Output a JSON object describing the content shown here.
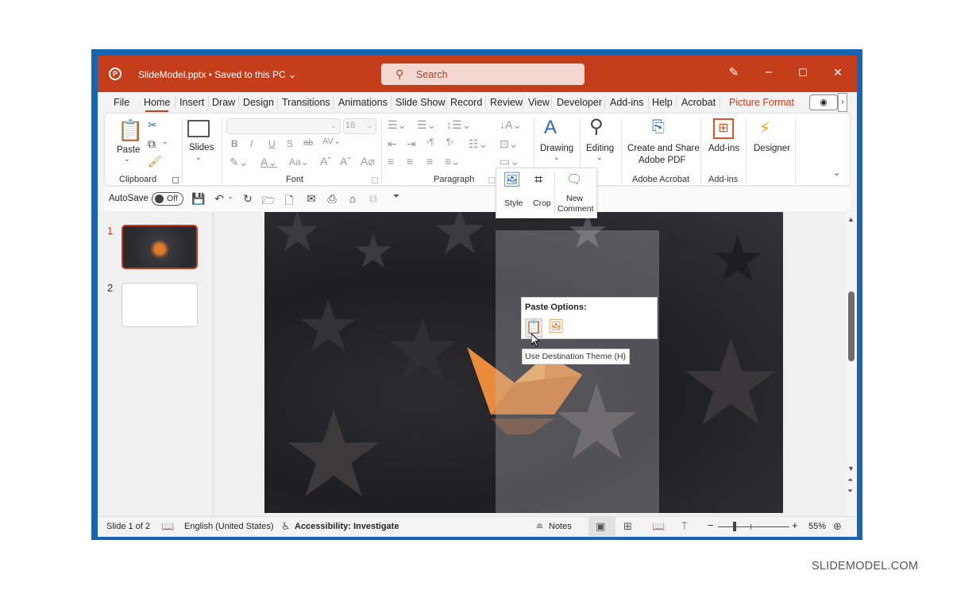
{
  "window": {
    "document_title": "SlideModel.pptx",
    "save_status": "Saved to this PC",
    "search_placeholder": "Search",
    "controls": {
      "pen": "pen-icon",
      "minimize": "–",
      "maximize": "☐",
      "close": "✕"
    }
  },
  "tabs": [
    {
      "label": "File"
    },
    {
      "label": "Home",
      "active": true
    },
    {
      "label": "Insert"
    },
    {
      "label": "Draw"
    },
    {
      "label": "Design"
    },
    {
      "label": "Transitions"
    },
    {
      "label": "Animations"
    },
    {
      "label": "Slide Show"
    },
    {
      "label": "Record"
    },
    {
      "label": "Review"
    },
    {
      "label": "View"
    },
    {
      "label": "Developer"
    },
    {
      "label": "Add-ins"
    },
    {
      "label": "Help"
    },
    {
      "label": "Acrobat"
    },
    {
      "label": "Picture Format",
      "contextual": true
    }
  ],
  "ribbon": {
    "clipboard": {
      "paste": "Paste",
      "group": "Clipboard"
    },
    "slides": {
      "label": "Slides"
    },
    "font": {
      "font_name": "",
      "font_size": "18",
      "group": "Font",
      "change_case": "Aa"
    },
    "paragraph": {
      "group": "Paragraph"
    },
    "drawing": {
      "label": "Drawing"
    },
    "editing": {
      "label": "Editing"
    },
    "acrobat": {
      "line1": "Create and Share",
      "line2": "Adobe PDF",
      "group": "Adobe Acrobat"
    },
    "addins": {
      "label": "Add-ins",
      "group": "Add-ins"
    },
    "designer": {
      "label": "Designer"
    }
  },
  "qat": {
    "autosave_label": "AutoSave",
    "autosave_state": "Off"
  },
  "mini_toolbar": {
    "style": "Style",
    "crop": "Crop",
    "new_comment_1": "New",
    "new_comment_2": "Comment"
  },
  "thumbnails": [
    {
      "number": "1",
      "selected": true
    },
    {
      "number": "2",
      "selected": false
    }
  ],
  "paste_options": {
    "title": "Paste Options:",
    "tooltip": "Use Destination Theme (H)"
  },
  "statusbar": {
    "slide_info": "Slide 1 of 2",
    "language": "English (United States)",
    "accessibility": "Accessibility: Investigate",
    "notes": "Notes",
    "zoom_minus": "−",
    "zoom_plus": "+",
    "zoom_level": "55%"
  },
  "colors": {
    "accent": "#c43e1c",
    "frame": "#1565b4"
  },
  "watermark": "SLIDEMODEL.COM"
}
